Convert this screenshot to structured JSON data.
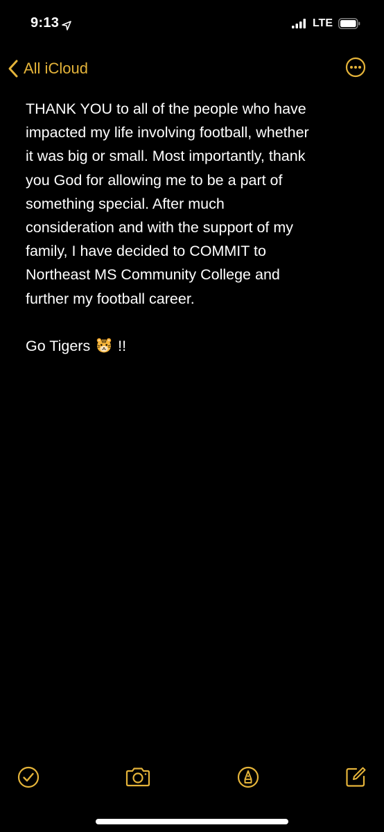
{
  "status_bar": {
    "time": "9:13",
    "network": "LTE",
    "location_icon": "location-arrow-icon",
    "signal_icon": "cellular-signal-icon",
    "battery_icon": "battery-icon"
  },
  "nav": {
    "back_label": "All iCloud",
    "back_icon": "chevron-left-icon",
    "more_icon": "ellipsis-circle-icon"
  },
  "note": {
    "lines": [
      "THANK YOU to all of the people who have",
      "impacted my life involving football, whether",
      "it was big or small. Most importantly, thank",
      "you God for allowing me to be a part of",
      "something special. After much",
      "consideration and with the support of my",
      "family, I have decided to COMMIT to",
      "Northeast MS Community College and",
      "further my football career."
    ],
    "closing_text": "Go Tigers",
    "closing_emoji": "tiger-face-icon",
    "closing_suffix": "!!"
  },
  "toolbar": {
    "items": [
      {
        "icon": "checklist-icon"
      },
      {
        "icon": "camera-icon"
      },
      {
        "icon": "markup-pen-icon"
      },
      {
        "icon": "compose-icon"
      }
    ]
  },
  "colors": {
    "accent": "#e5b43a",
    "background": "#000000",
    "text": "#ffffff"
  }
}
